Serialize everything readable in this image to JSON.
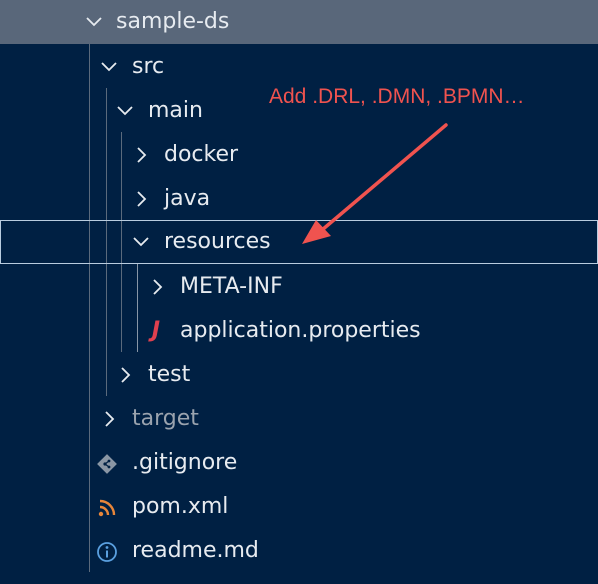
{
  "explorer": {
    "items": [
      {
        "label": "sample-ds",
        "kind": "folder",
        "state": "expanded",
        "icon": "chevron-down-icon"
      },
      {
        "label": "src",
        "kind": "folder",
        "state": "expanded",
        "icon": "chevron-down-icon"
      },
      {
        "label": "main",
        "kind": "folder",
        "state": "expanded",
        "icon": "chevron-down-icon"
      },
      {
        "label": "docker",
        "kind": "folder",
        "state": "collapsed",
        "icon": "chevron-right-icon"
      },
      {
        "label": "java",
        "kind": "folder",
        "state": "collapsed",
        "icon": "chevron-right-icon"
      },
      {
        "label": "resources",
        "kind": "folder",
        "state": "expanded",
        "selected": true,
        "icon": "chevron-down-icon"
      },
      {
        "label": "META-INF",
        "kind": "folder",
        "state": "collapsed",
        "icon": "chevron-right-icon"
      },
      {
        "label": "application.properties",
        "kind": "file",
        "icon": "java-properties-icon",
        "glyph": "J"
      },
      {
        "label": "test",
        "kind": "folder",
        "state": "collapsed",
        "icon": "chevron-right-icon"
      },
      {
        "label": "target",
        "kind": "folder",
        "state": "collapsed",
        "ignored": true,
        "icon": "chevron-right-icon"
      },
      {
        "label": ".gitignore",
        "kind": "file",
        "icon": "git-icon"
      },
      {
        "label": "pom.xml",
        "kind": "file",
        "icon": "rss-xml-icon"
      },
      {
        "label": "readme.md",
        "kind": "file",
        "icon": "info-icon"
      }
    ]
  },
  "annotation": {
    "text": "Add .DRL, .DMN, .BPMN…",
    "color": "#f0534f"
  },
  "colors": {
    "background": "#002043",
    "root_row": "#59677a",
    "selection_border": "#b9ccdf",
    "text": "#e7ebf0",
    "ignored_text": "#9aa3ae",
    "java_icon": "#e0404f",
    "xml_icon": "#e8863a",
    "info_icon": "#5aa0e0",
    "git_icon": "#8a96a4"
  }
}
